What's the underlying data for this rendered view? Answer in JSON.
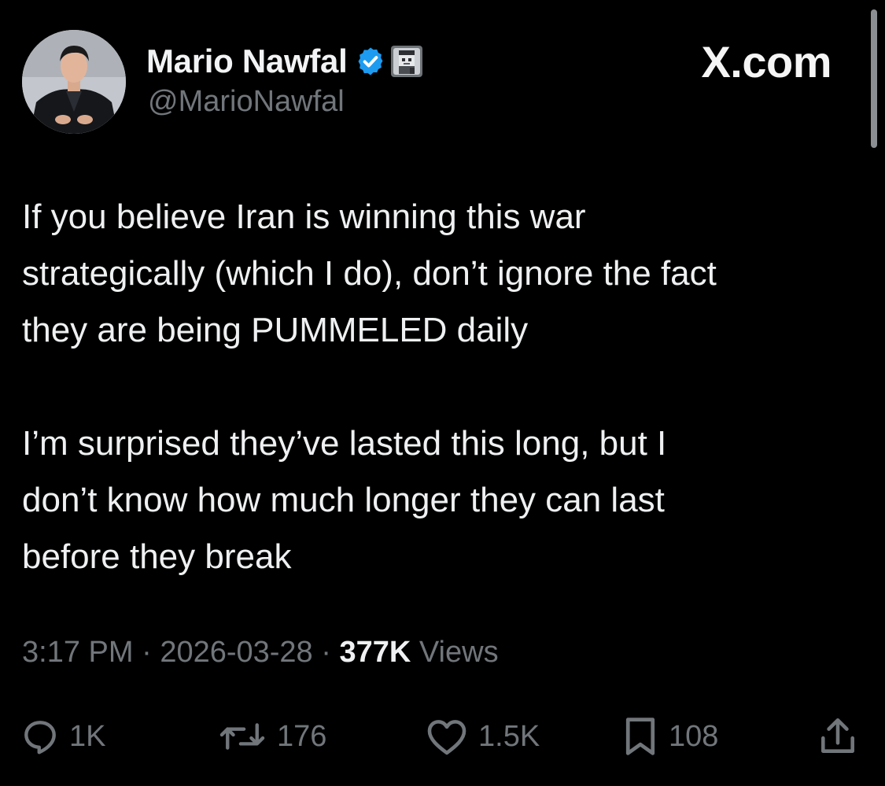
{
  "brand": {
    "watermark": "X.com"
  },
  "author": {
    "display_name": "Mario Nawfal",
    "handle": "@MarioNawfal",
    "verified_icon": "verified-badge-icon",
    "affiliate_icon": "pixel-avatar-affiliate-icon"
  },
  "tweet": {
    "paragraphs": [
      {
        "lines": [
          "If you believe Iran is winning this war",
          "strategically (which I do), don’t ignore the fact",
          "they are being PUMMELED daily"
        ]
      },
      {
        "lines": [
          "I’m surprised they’ve lasted this long, but I",
          "don’t know how much longer they can last",
          "before they break"
        ]
      }
    ]
  },
  "meta": {
    "time": "3:17 PM",
    "separator": "·",
    "date": "2026-03-28",
    "views_count": "377K",
    "views_label": "Views"
  },
  "actions": {
    "replies": "1K",
    "reposts": "176",
    "likes": "1.5K",
    "bookmarks": "108"
  },
  "colors": {
    "background": "#000000",
    "text": "#e7e9ea",
    "secondary": "#71767b",
    "verified": "#1d9bf0"
  }
}
